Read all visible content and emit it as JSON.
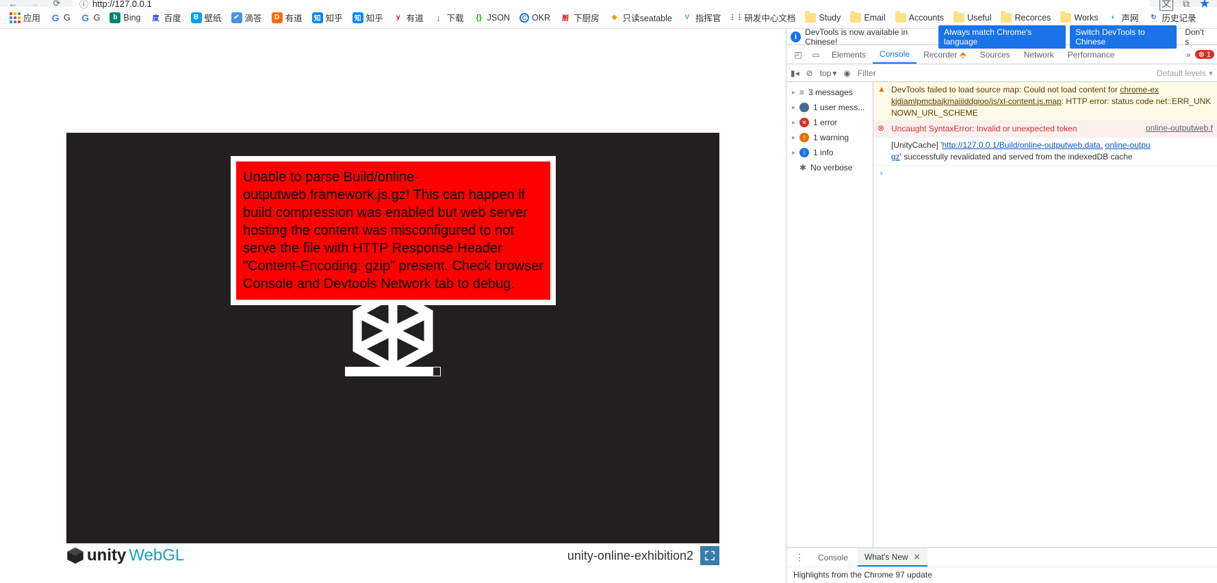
{
  "browser": {
    "url": "http://127.0.0.1"
  },
  "bookmarks": {
    "apps": "应用",
    "items": [
      {
        "label": "G",
        "color": "#4285f4"
      },
      {
        "label": "G",
        "color": "#4285f4"
      },
      {
        "label": "Bing",
        "color": "#008373",
        "icon": "b"
      },
      {
        "label": "百度",
        "color": "#2932e1",
        "icon": "百"
      },
      {
        "label": "壁纸",
        "color": "#00a1f1",
        "icon": "B"
      },
      {
        "label": "滴答",
        "color": "#4a90e2",
        "icon": "✔"
      },
      {
        "label": "有道",
        "color": "#ff6a00",
        "icon": "D"
      },
      {
        "label": "知乎",
        "color": "#0084ff",
        "icon": "知"
      },
      {
        "label": "知乎",
        "color": "#0084ff",
        "icon": "知"
      },
      {
        "label": "有道",
        "color": "#e60012",
        "icon": "y"
      },
      {
        "label": "下载",
        "color": "#1e88e5",
        "icon": "↓"
      },
      {
        "label": "JSON",
        "color": "#00b300",
        "icon": "{}"
      },
      {
        "label": "OKR",
        "color": "#1a73e8",
        "icon": "C"
      },
      {
        "label": "下厨房",
        "color": "#d51c1c",
        "icon": "厨"
      },
      {
        "label": "只读seatable",
        "color": "#ff9800",
        "icon": "◆"
      },
      {
        "label": "指挥官",
        "color": "#41b883",
        "icon": "V"
      },
      {
        "label": "研发中心文档",
        "color": "#333",
        "icon": "⋮"
      }
    ],
    "folders": [
      "Study",
      "Email",
      "Accounts",
      "Useful",
      "Recorces",
      "Works"
    ],
    "tail": [
      {
        "label": "声网",
        "color": "#00aeef",
        "icon": "◐"
      },
      {
        "label": "历史记录",
        "color": "#1a73e8",
        "icon": "↻"
      }
    ]
  },
  "page": {
    "error_text": "Unable to parse Build/online-outputweb.framework.js.gz! This can happen if build compression was enabled but web server hosting the content was misconfigured to not serve the file with HTTP Response Header \"Content-Encoding: gzip\" present. Check browser Console and Devtools Network tab to debug.",
    "brand_unity": "unity",
    "brand_webgl": "WebGL",
    "title": "unity-online-exhibition2"
  },
  "devtools": {
    "banner": {
      "text": "DevTools is now available in Chinese!",
      "btn1": "Always match Chrome's language",
      "btn2": "Switch DevTools to Chinese",
      "btn3": "Don't s"
    },
    "tabs": [
      "Elements",
      "Console",
      "Recorder",
      "Sources",
      "Network",
      "Performance"
    ],
    "active_tab": "Console",
    "error_count": "1",
    "toolbar": {
      "top": "top",
      "filter_placeholder": "Filter",
      "levels": "Default levels"
    },
    "sidebar": {
      "messages": "3 messages",
      "user": "1 user mess...",
      "errors": "1 error",
      "warnings": "1 warning",
      "info": "1 info",
      "verbose": "No verbose"
    },
    "console_msgs": {
      "warn_text": "DevTools failed to load source map: Could not load content for ",
      "warn_link1": "chrome-ex",
      "warn_link2": "kjdiamlpmcbajkmaiiiddgioo/js/xl-content.js.map",
      "warn_tail": ": HTTP error: status code net::ERR_UNKNOWN_URL_SCHEME",
      "err_text": "Uncaught SyntaxError: Invalid or unexpected token",
      "err_src": "online-outputweb.f",
      "info_pre": "[UnityCache] '",
      "info_link1": "http://127.0.0.1/Build/online-outputweb.data.",
      "info_link2": "online-outpu",
      "info_post1": "gz",
      "info_post2": "' successfully revalidated and served from the indexedDB cache"
    },
    "bottom_tabs": {
      "console": "Console",
      "whatsnew": "What's New"
    },
    "highlights": "Highlights from the Chrome 97 update"
  }
}
